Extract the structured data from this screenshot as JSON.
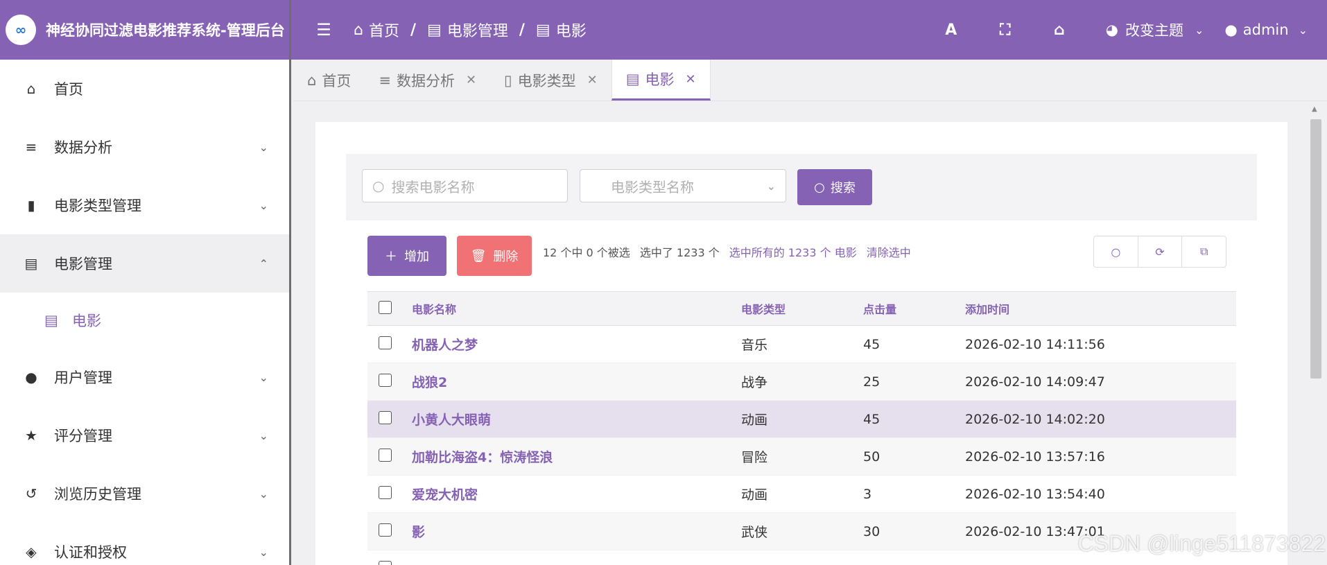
{
  "header": {
    "logo_text": "∞",
    "title": "神经协同过滤电影推荐系统-管理后台",
    "breadcrumb": [
      "首页",
      "电影管理",
      "电影"
    ],
    "theme_label": "改变主题",
    "user": "admin",
    "icons": [
      "font-icon",
      "fullscreen-icon",
      "home-icon",
      "palette-icon",
      "user-icon"
    ]
  },
  "sidebar": {
    "items": [
      {
        "label": "首页",
        "icon": "home-icon"
      },
      {
        "label": "数据分析",
        "icon": "database-icon"
      },
      {
        "label": "电影类型管理",
        "icon": "bookmark-icon"
      },
      {
        "label": "电影管理",
        "icon": "film-icon"
      },
      {
        "label": "用户管理",
        "icon": "user-icon"
      },
      {
        "label": "评分管理",
        "icon": "star-icon"
      },
      {
        "label": "浏览历史管理",
        "icon": "history-icon"
      },
      {
        "label": "认证和授权",
        "icon": "shield-icon"
      }
    ],
    "sub_item": {
      "label": "电影",
      "icon": "film-icon"
    }
  },
  "tabs": [
    {
      "label": "首页"
    },
    {
      "label": "数据分析"
    },
    {
      "label": "电影类型"
    },
    {
      "label": "电影"
    }
  ],
  "search": {
    "name_placeholder": "搜索电影名称",
    "type_placeholder": "电影类型名称",
    "button": "搜索"
  },
  "toolbar": {
    "add": "增加",
    "delete": "删除",
    "selected_count": "12 个中 0 个被选",
    "selected_total": "选中了 1233 个",
    "select_all": "选中所有的 1233 个 电影",
    "clear": "清除选中"
  },
  "table": {
    "headers": [
      "电影名称",
      "电影类型",
      "点击量",
      "添加时间"
    ],
    "rows": [
      [
        "机器人之梦",
        "音乐",
        "45",
        "2026-02-10 14:11:56"
      ],
      [
        "战狼2",
        "战争",
        "25",
        "2026-02-10 14:09:47"
      ],
      [
        "小黄人大眼萌",
        "动画",
        "45",
        "2026-02-10 14:02:20"
      ],
      [
        "加勒比海盗4：惊涛怪浪",
        "冒险",
        "50",
        "2026-02-10 13:57:16"
      ],
      [
        "爱宠大机密",
        "动画",
        "3",
        "2026-02-10 13:54:40"
      ],
      [
        "影",
        "武侠",
        "30",
        "2026-02-10 13:47:01"
      ],
      [
        "",
        "",
        "",
        ""
      ]
    ]
  },
  "watermark": "CSDN @linge511873822",
  "colors": {
    "primary": "#8562b3",
    "danger": "#f07275"
  }
}
